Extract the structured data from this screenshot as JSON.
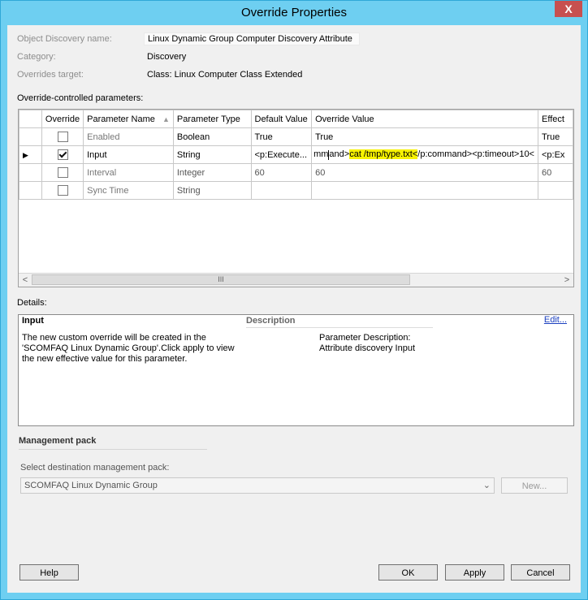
{
  "window": {
    "title": "Override Properties",
    "close_glyph": "X"
  },
  "info": {
    "object_label": "Object Discovery name:",
    "object_value": "Linux Dynamic Group Computer Discovery Attribute",
    "category_label": "Category:",
    "category_value": "Discovery",
    "target_label": "Overrides target:",
    "target_value": "Class: Linux Computer Class Extended"
  },
  "params": {
    "heading": "Override-controlled parameters:",
    "columns": [
      "Override",
      "Parameter Name",
      "Parameter Type",
      "Default Value",
      "Override Value",
      "Effect"
    ],
    "rows": [
      {
        "override": false,
        "name": "Enabled",
        "type": "Boolean",
        "default": "True",
        "override_value": "True",
        "effective": "True"
      },
      {
        "override": true,
        "name": "Input",
        "type": "String",
        "default": "<p:Execute...",
        "override_value": "",
        "effective": "<p:Ex"
      },
      {
        "override": false,
        "name": "Interval",
        "type": "Integer",
        "default": "60",
        "override_value": "60",
        "effective": "60"
      },
      {
        "override": false,
        "name": "Sync Time",
        "type": "String",
        "default": "",
        "override_value": "",
        "effective": ""
      }
    ],
    "input_value_pre": "mm",
    "input_value_mid": "and>",
    "input_value_highlight": "cat /tmp/type.txt<",
    "input_value_post": "/p:command><p:timeout>10<",
    "scroll_thumb": "III",
    "scroll_left": "<",
    "scroll_right": ">"
  },
  "details": {
    "heading": "Details:",
    "title": "Input",
    "description_header": "Description",
    "edit_link": "Edit...",
    "left_text": "The new custom override will be created in the 'SCOMFAQ Linux Dynamic Group'.Click apply to view the new effective value for this parameter.",
    "right_line1": "Parameter Description:",
    "right_line2": "Attribute discovery Input"
  },
  "mp": {
    "section_title": "Management pack",
    "select_label": "Select destination management pack:",
    "selected": "SCOMFAQ Linux Dynamic Group",
    "new_button": "New..."
  },
  "buttons": {
    "help": "Help",
    "ok": "OK",
    "apply": "Apply",
    "cancel": "Cancel"
  },
  "colors": {
    "frame": "#6ecff1",
    "highlight": "#f7f200",
    "close": "#c75050"
  }
}
